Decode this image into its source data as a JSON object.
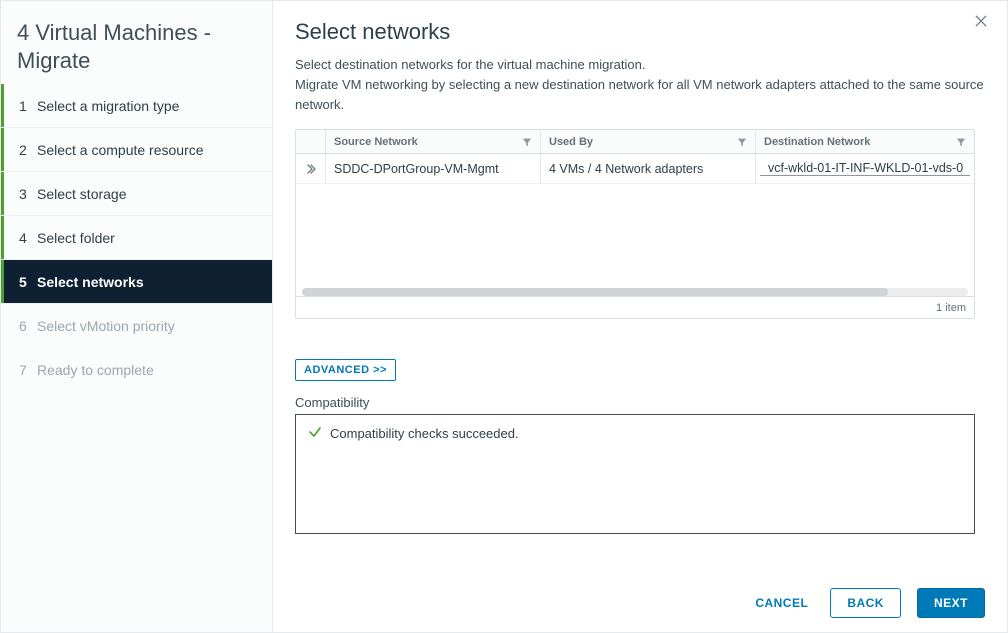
{
  "sidebar": {
    "title": "4 Virtual Machines - Migrate",
    "steps": [
      {
        "num": "1",
        "label": "Select a migration type",
        "state": "completed"
      },
      {
        "num": "2",
        "label": "Select a compute resource",
        "state": "completed"
      },
      {
        "num": "3",
        "label": "Select storage",
        "state": "completed"
      },
      {
        "num": "4",
        "label": "Select folder",
        "state": "completed"
      },
      {
        "num": "5",
        "label": "Select networks",
        "state": "active"
      },
      {
        "num": "6",
        "label": "Select vMotion priority",
        "state": "future"
      },
      {
        "num": "7",
        "label": "Ready to complete",
        "state": "future"
      }
    ]
  },
  "main": {
    "title": "Select networks",
    "desc_line1": "Select destination networks for the virtual machine migration.",
    "desc_line2": "Migrate VM networking by selecting a new destination network for all VM network adapters attached to the same source network.",
    "table": {
      "headers": {
        "source": "Source Network",
        "used_by": "Used By",
        "destination": "Destination Network"
      },
      "rows": [
        {
          "source": "SDDC-DPortGroup-VM-Mgmt",
          "used_by": "4 VMs / 4 Network adapters",
          "destination": "vcf-wkld-01-IT-INF-WKLD-01-vds-0"
        }
      ],
      "footer_count": "1 item"
    },
    "advanced_label": "ADVANCED >>",
    "compatibility": {
      "heading": "Compatibility",
      "message": "Compatibility checks succeeded."
    }
  },
  "footer": {
    "cancel": "CANCEL",
    "back": "BACK",
    "next": "NEXT"
  }
}
